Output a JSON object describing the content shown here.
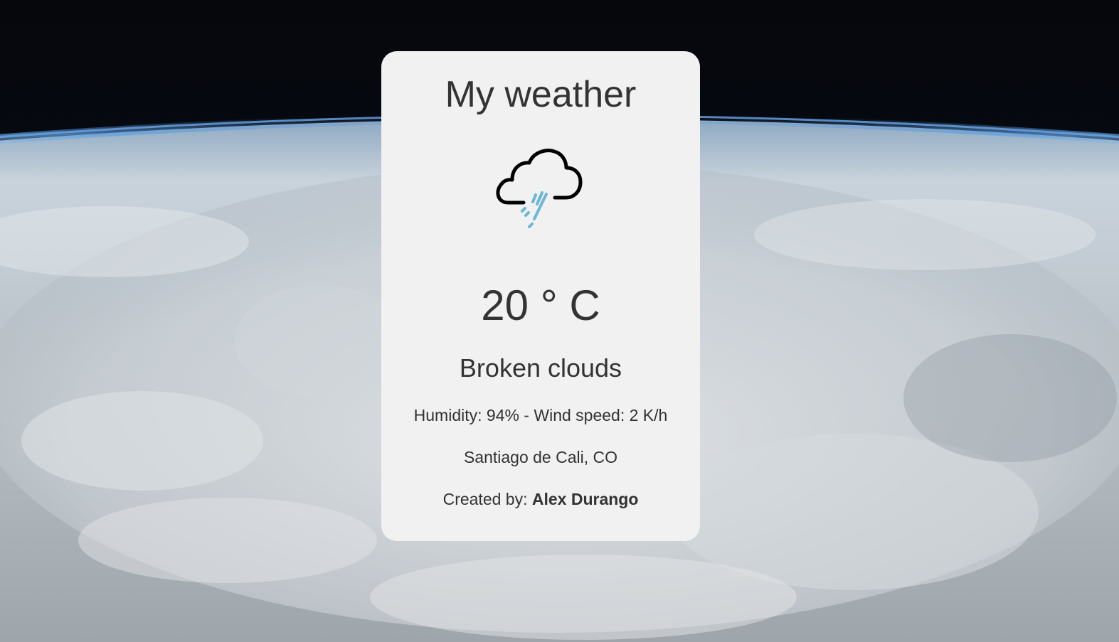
{
  "app": {
    "title": "My weather"
  },
  "weather": {
    "icon": "rain-cloud-icon",
    "temperature": "20 ° C",
    "description": "Broken clouds",
    "details": "Humidity: 94% - Wind speed: 2 K/h",
    "location": "Santiago de Cali, CO"
  },
  "footer": {
    "created_by_label": "Created by:",
    "author": "Alex Durango"
  },
  "colors": {
    "card_background": "#f1f1f1",
    "text": "#333333",
    "rain_accent": "#6bb6d9",
    "space": "#05070c"
  }
}
